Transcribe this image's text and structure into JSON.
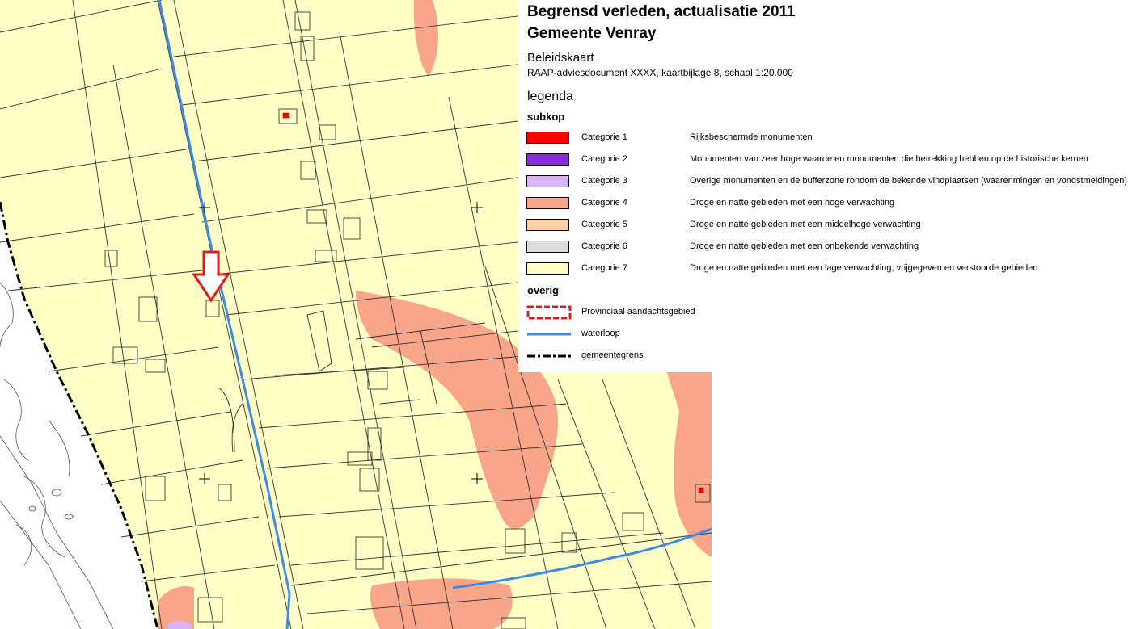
{
  "title": {
    "line1": "Begrensd verleden, actualisatie 2011",
    "line2": "Gemeente Venray",
    "map_kind": "Beleidskaart",
    "subtitle": "RAAP-adviesdocument XXXX, kaartbijlage 8, schaal 1:20.000"
  },
  "legend": {
    "heading": "legenda",
    "subkop": "subkop",
    "categories": [
      {
        "label": "Categorie 1",
        "description": "Rijksbeschermde monumenten",
        "color": "#ff0000"
      },
      {
        "label": "Categorie 2",
        "description": "Monumenten van zeer hoge waarde en monumenten die betrekking hebben op de historische kernen",
        "color": "#8a2be2"
      },
      {
        "label": "Categorie 3",
        "description": "Overige monumenten en de bufferzone rondom de bekende vindplaatsen (waarenmingen en vondstmeldingen)",
        "color": "#d8b4f8"
      },
      {
        "label": "Categorie 4",
        "description": "Droge en natte gebieden met een hoge verwachting",
        "color": "#f9a58a"
      },
      {
        "label": "Categorie 5",
        "description": "Droge en natte gebieden met een middelhoge verwachting",
        "color": "#fcd0a8"
      },
      {
        "label": "Categorie 6",
        "description": "Droge en natte gebieden met een onbekende verwachting",
        "color": "#dcdcdc"
      },
      {
        "label": "Categorie 7",
        "description": "Droge en natte gebieden met een lage verwachting, vrijgegeven en verstoorde gebieden",
        "color": "#ffffc6"
      }
    ],
    "overig": "overig",
    "other_items": [
      {
        "label": "Provinciaal aandachtsgebied",
        "symbol": "dashed-red-box",
        "color": "#e31a1c"
      },
      {
        "label": "waterloop",
        "symbol": "blue-line",
        "color": "#3c8ce6"
      },
      {
        "label": "gemeentegrens",
        "symbol": "dash-dot-line",
        "color": "#000000"
      }
    ]
  },
  "map": {
    "base_color": "#ffffc6",
    "high_expectation_color": "#f9a58a",
    "water_color": "#3c8ce6",
    "marker_color": "#e31a1c"
  }
}
